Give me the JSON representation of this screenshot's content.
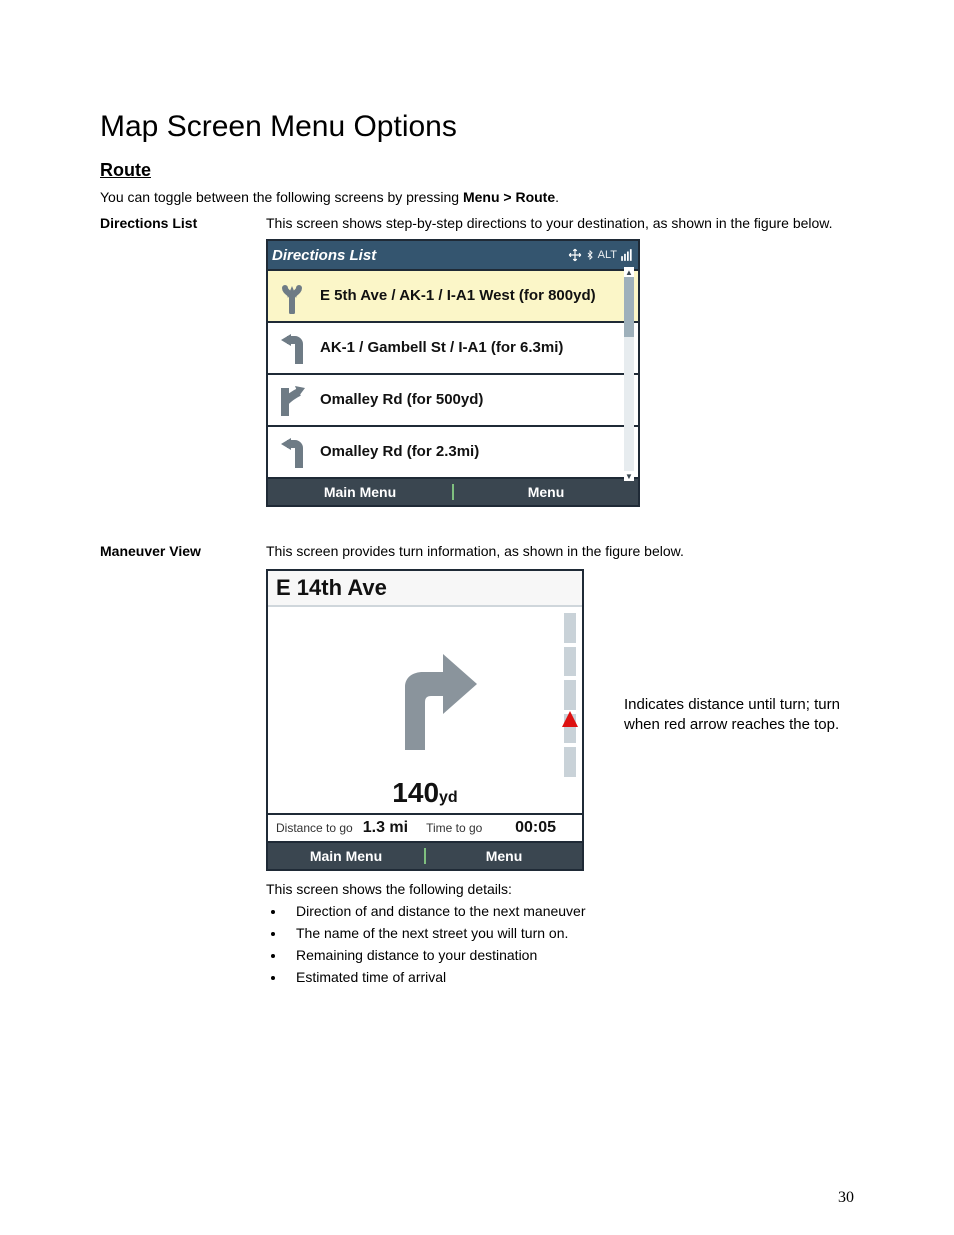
{
  "page": {
    "title": "Map Screen Menu Options",
    "number": "30"
  },
  "route": {
    "heading": "Route",
    "intro_prefix": "You can toggle between the following screens by pressing ",
    "intro_bold": "Menu > Route",
    "intro_suffix": "."
  },
  "directions_list": {
    "term": "Directions List",
    "desc": "This screen shows step-by-step directions to your destination, as shown in the figure below.",
    "header_title": "Directions List",
    "header_alt": "ALT",
    "rows": [
      {
        "text": "E 5th Ave / AK-1 / I-A1 West (for 800yd)",
        "highlight": true,
        "icon": "merge-icon"
      },
      {
        "text": "AK-1 / Gambell St / I-A1 (for 6.3mi)",
        "highlight": false,
        "icon": "turn-left-icon"
      },
      {
        "text": "Omalley Rd (for 500yd)",
        "highlight": false,
        "icon": "ramp-right-icon"
      },
      {
        "text": "Omalley Rd (for 2.3mi)",
        "highlight": false,
        "icon": "turn-left-icon"
      }
    ],
    "footer": {
      "left": "Main Menu",
      "right": "Menu"
    }
  },
  "maneuver_view": {
    "term": "Maneuver View",
    "desc": "This screen provides turn information, as shown in the figure below.",
    "street": "E 14th Ave",
    "distance_value": "140",
    "distance_unit": "yd",
    "info": {
      "distance_label": "Distance to go",
      "distance_value": "1.3 mi",
      "time_label": "Time to go",
      "time_value": "00:05"
    },
    "footer": {
      "left": "Main Menu",
      "right": "Menu"
    },
    "caption": "Indicates distance until turn; turn when red arrow reaches the top.",
    "details_intro": "This screen shows the following details:",
    "details": [
      "Direction of and distance to the next maneuver",
      "The name of the next street you will turn on.",
      "Remaining distance to your destination",
      "Estimated time of arrival"
    ]
  }
}
